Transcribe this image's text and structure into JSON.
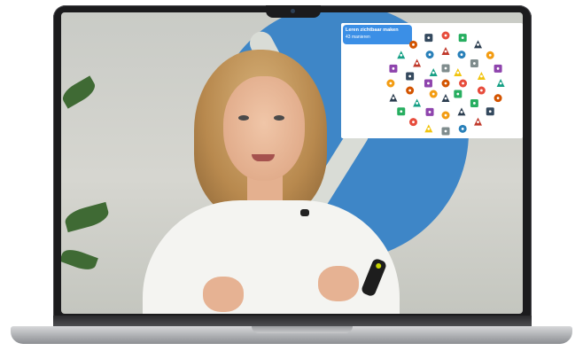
{
  "overlay": {
    "title": "Leren zichtbaar maken",
    "subtitle": "43 manieren",
    "accent_color": "#3b8fe6",
    "icon_count": 43,
    "icons": [
      "stopwatch-icon",
      "lightbulb-icon",
      "presentation-icon",
      "chart-icon",
      "pencil-icon",
      "globe-icon",
      "book-icon",
      "calendar-icon",
      "star-icon",
      "brain-icon",
      "question-icon",
      "clipboard-icon",
      "target-icon",
      "puzzle-icon",
      "trophy-icon",
      "clock-icon",
      "map-icon",
      "chat-icon",
      "flag-icon",
      "dice-icon",
      "camera-icon",
      "music-icon",
      "gear-icon",
      "network-icon",
      "rocket-icon",
      "hand-icon",
      "eye-icon",
      "medal-icon",
      "paint-icon",
      "headphones-icon",
      "gamepad-icon",
      "magnifier-icon",
      "dna-icon",
      "flask-icon",
      "leaf-icon",
      "heart-icon",
      "computer-icon",
      "key-icon",
      "ruler-icon",
      "scale-icon",
      "compass-icon",
      "bell-icon",
      "checklist-icon"
    ]
  },
  "colors": {
    "logo_blue": "#3e86c7",
    "wall": "#d6d6d0",
    "laptop_frame": "#1b1b1d"
  }
}
